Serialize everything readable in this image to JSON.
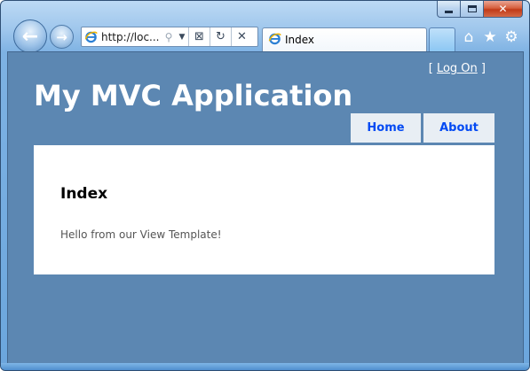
{
  "browser": {
    "address_url": "http://loc...",
    "tab_title": "Index",
    "icons": {
      "back": "back-arrow-icon",
      "forward": "forward-arrow-icon",
      "compat": "compatibility-view-icon",
      "refresh": "refresh-icon",
      "stop": "stop-icon",
      "home": "home-icon",
      "favorites": "star-icon",
      "tools": "gear-icon"
    }
  },
  "page": {
    "logon_open_bracket": "[",
    "logon_label": "Log On",
    "logon_close_bracket": "]",
    "site_title": "My MVC Application",
    "menu": [
      {
        "label": "Home"
      },
      {
        "label": "About"
      }
    ],
    "heading": "Index",
    "body_text": "Hello from our View Template!"
  },
  "colors": {
    "page_background": "#5c87b2",
    "menu_link": "#034af3",
    "menu_background": "#e8eef4"
  }
}
